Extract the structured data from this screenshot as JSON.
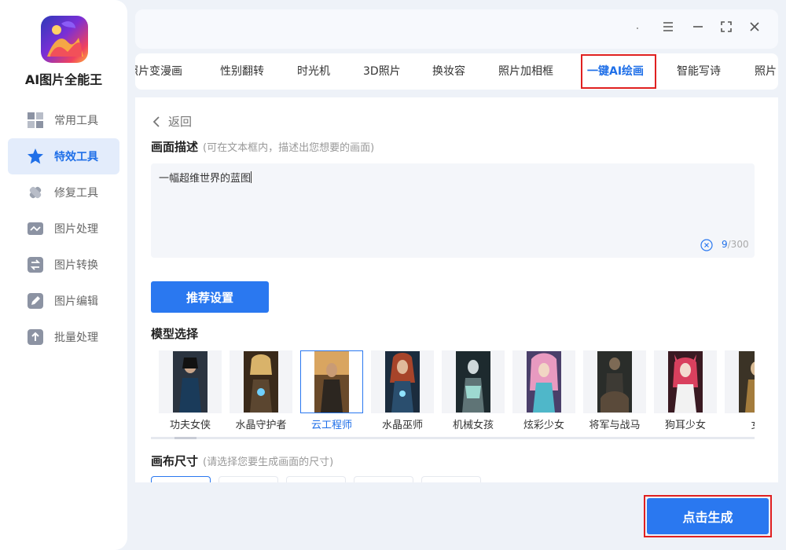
{
  "app": {
    "title": "AI图片全能王"
  },
  "sidebar": {
    "items": [
      {
        "label": "常用工具",
        "icon": "grid-icon",
        "active": false
      },
      {
        "label": "特效工具",
        "icon": "star-icon",
        "active": true
      },
      {
        "label": "修复工具",
        "icon": "bandage-icon",
        "active": false
      },
      {
        "label": "图片处理",
        "icon": "image-wave-icon",
        "active": false
      },
      {
        "label": "图片转换",
        "icon": "convert-icon",
        "active": false
      },
      {
        "label": "图片编辑",
        "icon": "edit-icon",
        "active": false
      },
      {
        "label": "批量处理",
        "icon": "upload-icon",
        "active": false
      }
    ]
  },
  "tabs": [
    {
      "label": "照片变漫画"
    },
    {
      "label": "性别翻转"
    },
    {
      "label": "时光机"
    },
    {
      "label": "3D照片"
    },
    {
      "label": "换妆容"
    },
    {
      "label": "照片加相框"
    },
    {
      "label": "一键AI绘画",
      "active": true
    },
    {
      "label": "智能写诗"
    },
    {
      "label": "照片"
    }
  ],
  "main": {
    "back_label": "返回",
    "description": {
      "title": "画面描述",
      "hint": "(可在文本框内，描述出您想要的画面)",
      "value": "一幅超维世界的蓝图",
      "count": "9",
      "max": "/300"
    },
    "recommend_button": "推荐设置",
    "model_section": {
      "title": "模型选择"
    },
    "models": [
      {
        "label": "功夫女侠",
        "selected": false
      },
      {
        "label": "水晶守护者",
        "selected": false
      },
      {
        "label": "云工程师",
        "selected": true
      },
      {
        "label": "水晶巫师",
        "selected": false
      },
      {
        "label": "机械女孩",
        "selected": false
      },
      {
        "label": "炫彩少女",
        "selected": false
      },
      {
        "label": "将军与战马",
        "selected": false
      },
      {
        "label": "狗耳少女",
        "selected": false
      },
      {
        "label": "女",
        "selected": false
      }
    ],
    "canvas_size": {
      "title": "画布尺寸",
      "hint": "(请选择您要生成画面的尺寸)"
    }
  },
  "generate_button": "点击生成",
  "colors": {
    "accent": "#2a78f0",
    "highlight_border": "#e02020",
    "background": "#eef2f8"
  }
}
